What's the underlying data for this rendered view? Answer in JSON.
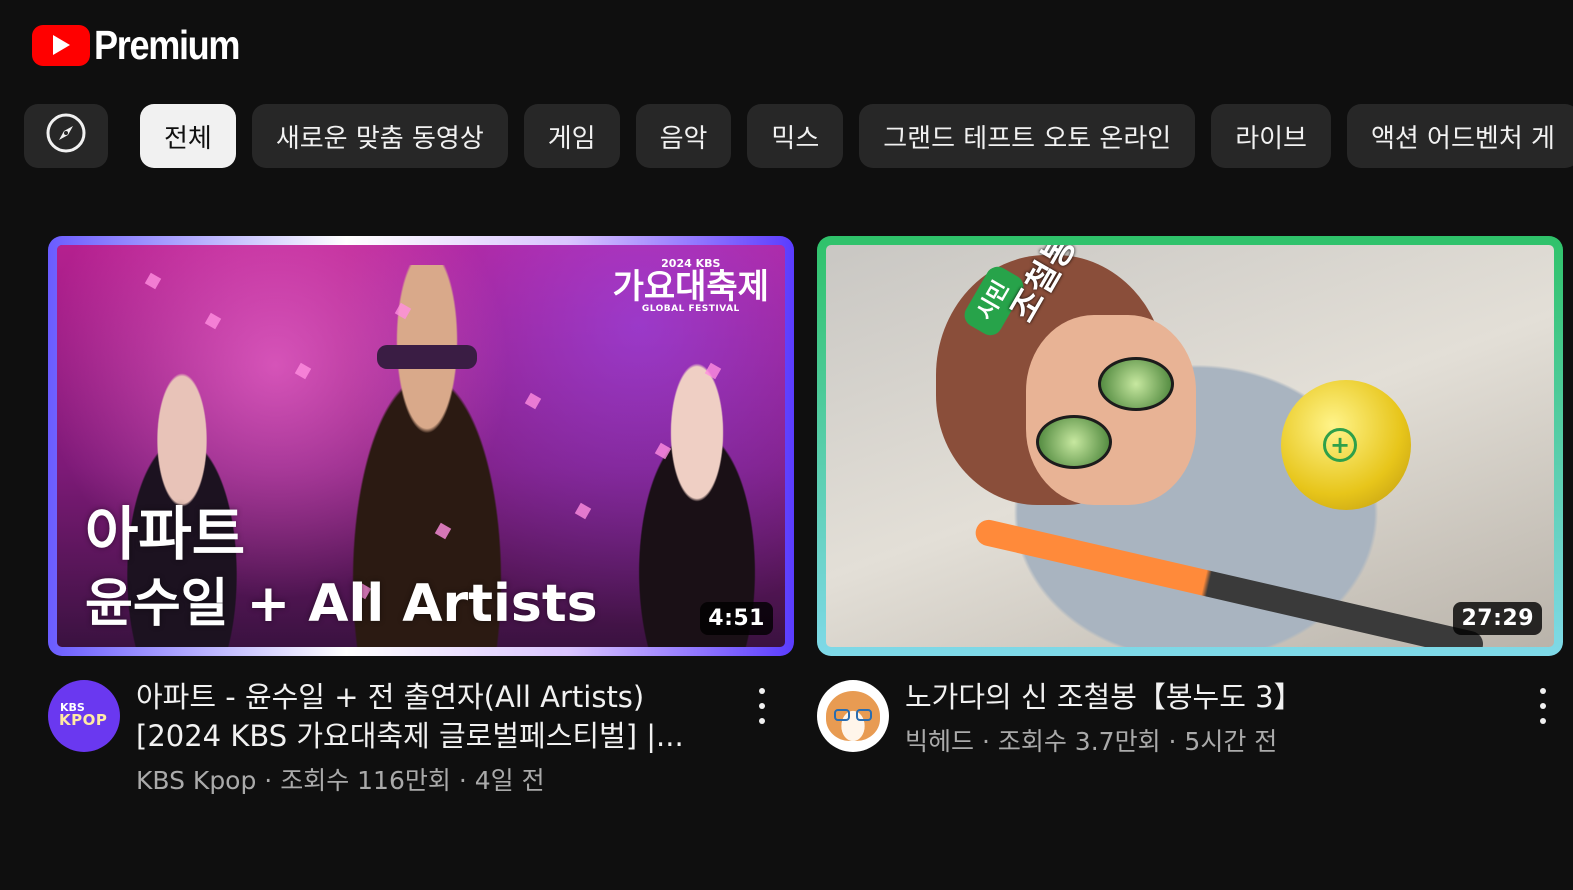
{
  "header": {
    "brand": "Premium"
  },
  "chips": [
    {
      "label": "전체",
      "active": true
    },
    {
      "label": "새로운 맞춤 동영상",
      "active": false
    },
    {
      "label": "게임",
      "active": false
    },
    {
      "label": "음악",
      "active": false
    },
    {
      "label": "믹스",
      "active": false
    },
    {
      "label": "그랜드 테프트 오토 온라인",
      "active": false
    },
    {
      "label": "라이브",
      "active": false
    },
    {
      "label": "액션 어드벤처 게",
      "active": false
    }
  ],
  "videos": [
    {
      "thumbnail": {
        "brand_year": "2024 KBS",
        "brand_title": "가요대축제",
        "brand_sub": "GLOBAL FESTIVAL",
        "overlay_line1": "아파트",
        "overlay_line2": "윤수일 + All Artists"
      },
      "duration": "4:51",
      "title": "아파트 - 윤수일 + 전 출연자(All Artists) [2024 KBS 가요대축제 글로벌페스티벌] |...",
      "avatar_line1": "KBS",
      "avatar_line2": "KPOP",
      "channel": "KBS Kpop",
      "views": "조회수 116만회",
      "age": "4일 전",
      "separator": " · "
    },
    {
      "thumbnail": {
        "cap_text": "시민",
        "tattoo_text": "조철봉"
      },
      "duration": "27:29",
      "title": "노가다의 신 조철봉【봉누도 3】",
      "channel": "빅헤드",
      "views": "조회수 3.7만회",
      "age": "5시간 전",
      "separator": " · "
    }
  ],
  "colors": {
    "background": "#0f0f0f",
    "chip_bg": "#272727",
    "chip_active_bg": "#f1f1f1",
    "brand_red": "#ff0000",
    "secondary_text": "#aaaaaa"
  },
  "icons": {
    "logo": "youtube-play-icon",
    "explore": "compass-icon",
    "menu": "more-vert-icon"
  }
}
